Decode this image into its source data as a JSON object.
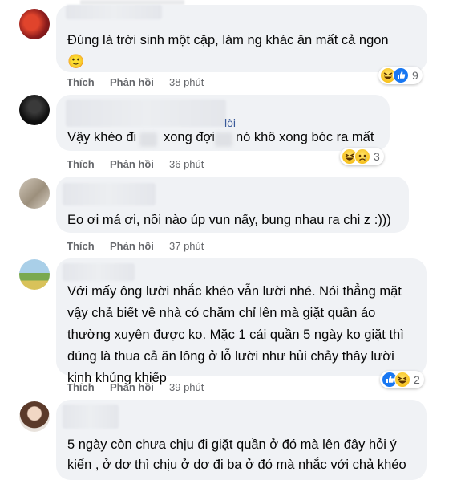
{
  "actions": {
    "like": "Thích",
    "reply": "Phản hồi"
  },
  "comments": [
    {
      "text_lines": [
        "Đúng là trời sinh một cặp, làm ng khác ăn mất cả ngon",
        "🙂"
      ],
      "time": "38 phút",
      "reaction_count": "9",
      "reactions": [
        "haha-icon",
        "like-icon"
      ]
    },
    {
      "partial_name_fragment": "lòi",
      "text_lines": [
        "Vậy khéo đi",
        "xong đợi",
        "nó khô xong bóc ra mất"
      ],
      "time": "36 phút",
      "reaction_count": "3",
      "reactions": [
        "haha-icon",
        "sad-icon"
      ]
    },
    {
      "text_lines": [
        "Eo ơi má ơi, nồi nào úp vun nấy, bung nhau ra chi z :)))"
      ],
      "time": "37 phút"
    },
    {
      "text_lines": [
        "Với mấy ông lười nhắc khéo vẫn lười nhé. Nói thẳng mặt",
        "vậy chả biết về nhà có chăm chỉ lên mà giặt quần áo",
        "thường xuyên được ko. Mặc 1 cái quần 5 ngày ko giặt thì",
        "đúng là thua cả ăn lông ở lỗ lười như hủi chảy thây lười",
        "kinh khủng khiếp"
      ],
      "time": "39 phút",
      "reaction_count": "2",
      "reactions": [
        "like-icon",
        "haha-icon"
      ]
    },
    {
      "text_lines": [
        "5 ngày còn chưa chịu đi giặt quần ở đó mà lên đây hỏi ý",
        "kiến , ở dơ thì chịu ở dơ đi ba ở đó mà nhắc với chả khéo"
      ]
    }
  ],
  "colors": {
    "bubble": "#f0f2f5",
    "meta": "#65676b",
    "like_blue": "#1877f2",
    "haha_yellow": "#f7b928"
  }
}
